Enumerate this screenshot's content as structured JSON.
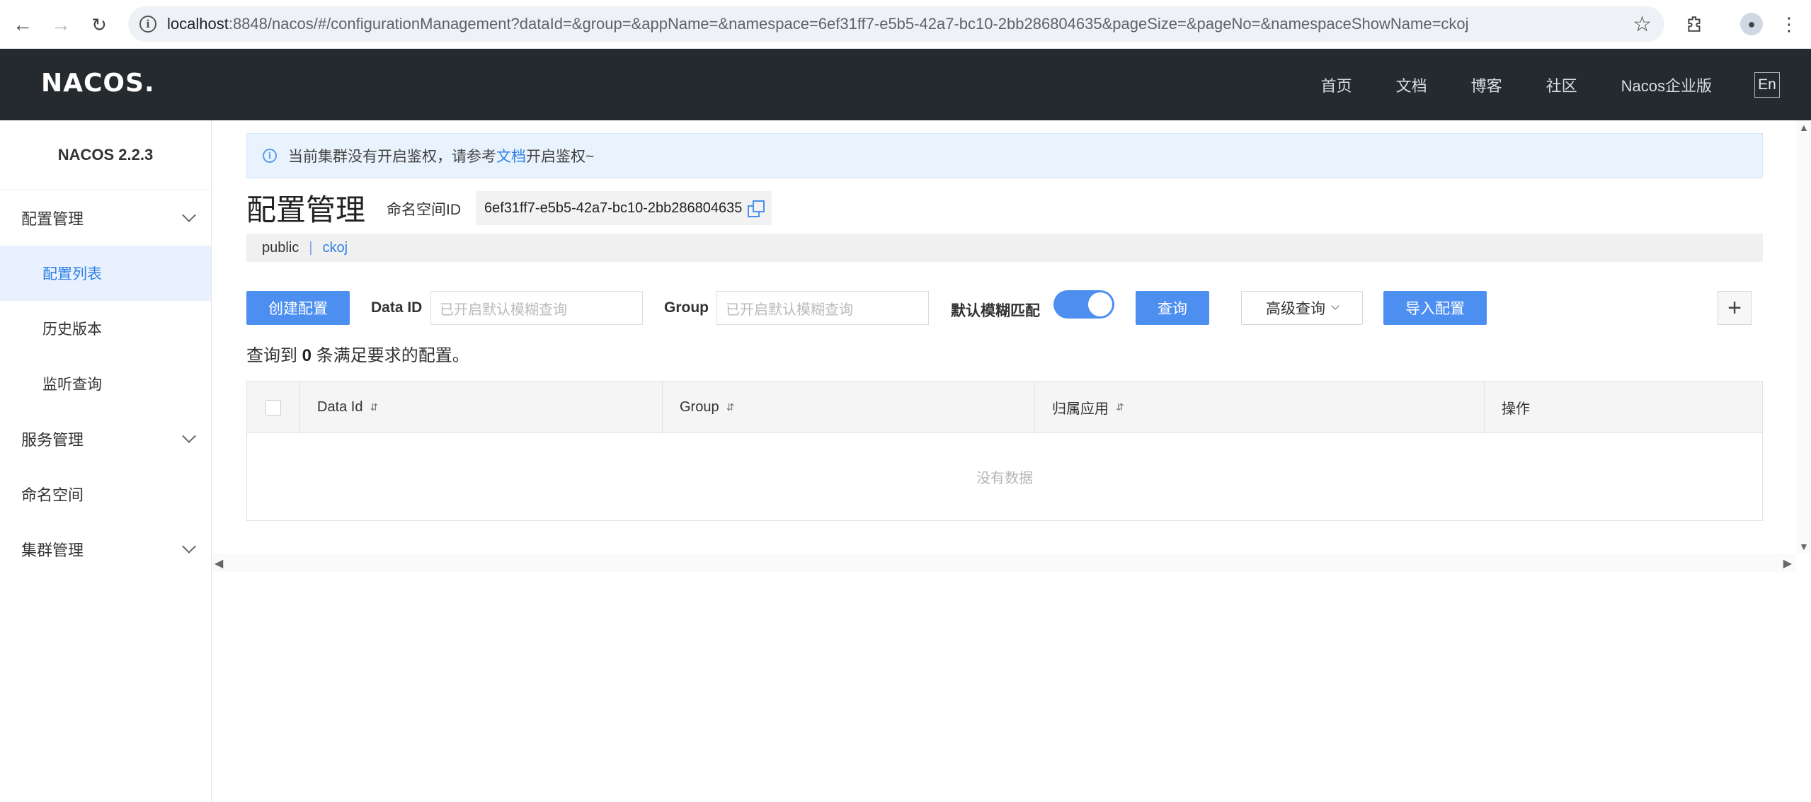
{
  "browser": {
    "url_host": "localhost",
    "url_rest": ":8848/nacos/#/configurationManagement?dataId=&group=&appName=&namespace=6ef31ff7-e5b5-42a7-bc10-2bb286804635&pageSize=&pageNo=&namespaceShowName=ckoj"
  },
  "header": {
    "logo": "NACOS.",
    "nav": [
      "首页",
      "文档",
      "博客",
      "社区",
      "Nacos企业版"
    ],
    "lang": "En"
  },
  "sidebar": {
    "version": "NACOS 2.2.3",
    "config_group": "配置管理",
    "config_items": [
      "配置列表",
      "历史版本",
      "监听查询"
    ],
    "service_group": "服务管理",
    "namespace_item": "命名空间",
    "cluster_group": "集群管理"
  },
  "notice": {
    "before": "当前集群没有开启鉴权，请参考",
    "link": "文档",
    "after": "开启鉴权~"
  },
  "page": {
    "title": "配置管理",
    "ns_label": "命名空间ID",
    "ns_id": "6ef31ff7-e5b5-42a7-bc10-2bb286804635",
    "ns_public": "public",
    "ns_sep": "|",
    "ns_current": "ckoj"
  },
  "toolbar": {
    "create": "创建配置",
    "dataid_label": "Data ID",
    "dataid_placeholder": "已开启默认模糊查询",
    "group_label": "Group",
    "group_placeholder": "已开启默认模糊查询",
    "fuzzy_label": "默认模糊匹配",
    "fuzzy_on": true,
    "query": "查询",
    "advanced": "高级查询",
    "import": "导入配置",
    "plus": "+"
  },
  "result": {
    "prefix": "查询到",
    "count": "0",
    "suffix": "条满足要求的配置。"
  },
  "table": {
    "columns": [
      "Data Id",
      "Group",
      "归属应用",
      "操作"
    ],
    "empty": "没有数据"
  },
  "colors": {
    "primary": "#4d8ff0",
    "header_bg": "#252a2f",
    "active_bg": "#e8f1fd"
  }
}
